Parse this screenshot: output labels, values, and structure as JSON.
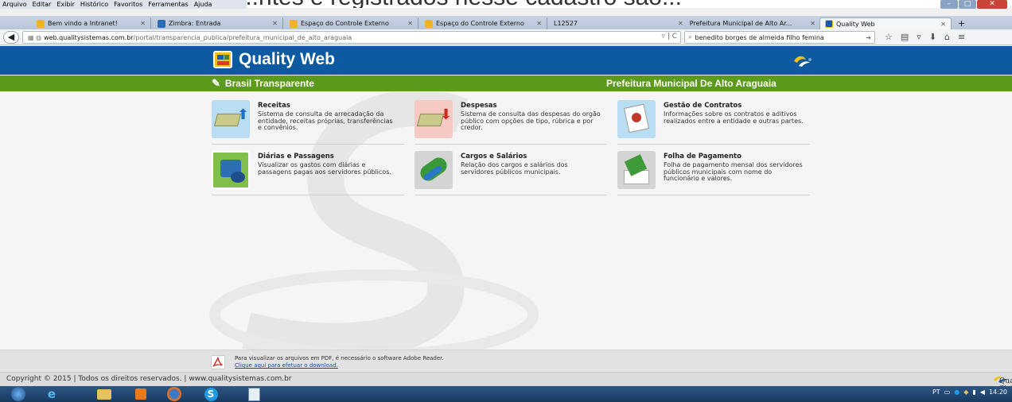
{
  "browser": {
    "banner_text": "...ntes e registrados nesse cadastro são...",
    "menu": [
      "Arquivo",
      "Editar",
      "Exibir",
      "Histórico",
      "Favoritos",
      "Ferramentas",
      "Ajuda"
    ],
    "tabs": [
      {
        "label": "Bem vindo a Intranet!",
        "active": false
      },
      {
        "label": "Zimbra: Entrada",
        "active": false
      },
      {
        "label": "Espaço do Controle Externo",
        "active": false
      },
      {
        "label": "Espaço do Controle Externo",
        "active": false
      },
      {
        "label": "L12527",
        "active": false
      },
      {
        "label": "Prefeitura Municipal de Alto Ar...",
        "active": false
      },
      {
        "label": "Quality Web",
        "active": true
      }
    ],
    "url_domain": "web.qualitysistemas.com.br",
    "url_path": "/portal/transparencia_publica/prefeitura_municipal_de_alto_araguaia",
    "search_value": "benedito borges de almeida filho femina"
  },
  "site": {
    "logo_text": "Quality Web",
    "section_label": "Brasil Transparente",
    "entity_name": "Prefeitura Municipal De Alto Araguaia"
  },
  "cards": [
    {
      "title": "Receitas",
      "description": "Sistema de consulta de arrecadação da entidade, receitas próprias, transferências e convênios."
    },
    {
      "title": "Despesas",
      "description": "Sistema de consulta das despesas do orgão público com opções de tipo, rúbrica e por credor."
    },
    {
      "title": "Gestão de Contratos",
      "description": "Informações sobre os contratos e aditivos realizados entre a entidade e outras partes."
    },
    {
      "title": "Diárias e Passagens",
      "description": "Visualizar os gastos com diárias e passagens pagas aos servidores públicos."
    },
    {
      "title": "Cargos e Salários",
      "description": "Relação dos cargos e salários dos servidores públicos municipais."
    },
    {
      "title": "Folha de Pagamento",
      "description": "Folha de pagamento mensal dos servidores públicos municipais com nome do funcionário e valores."
    }
  ],
  "footer": {
    "pdf_notice": "Para visualizar os arquivos em PDF, é necessário o software Adobe Reader.",
    "pdf_link": "Clique aqui para efetuar o download.",
    "copyright": "Copyright © 2015 | Todos os direitos reservados. | www.qualitysistemas.com.br",
    "brand": "Quality Sistemas"
  },
  "taskbar": {
    "lang": "PT",
    "time": "14:20"
  }
}
